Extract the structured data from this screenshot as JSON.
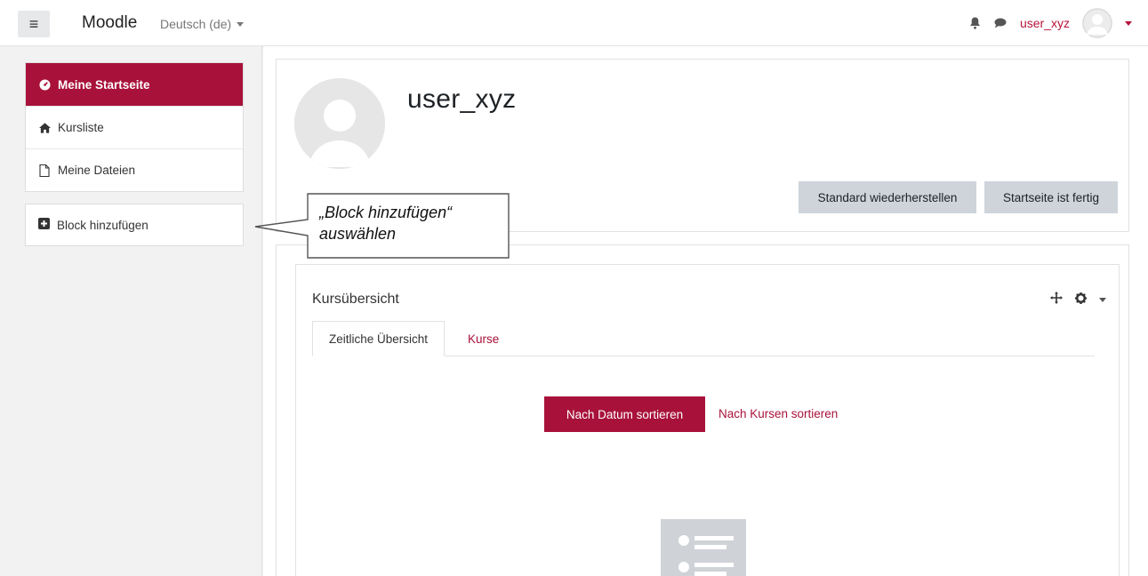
{
  "navbar": {
    "brand": "Moodle",
    "language": "Deutsch (de)",
    "username": "user_xyz",
    "icons": [
      "menu-icon",
      "bell-icon",
      "chat-icon",
      "avatar",
      "chevron-down-icon"
    ]
  },
  "drawer": {
    "items": [
      {
        "label": "Meine Startseite",
        "icon": "dashboard-icon",
        "active": true
      },
      {
        "label": "Kursliste",
        "icon": "home-icon",
        "active": false
      },
      {
        "label": "Meine Dateien",
        "icon": "file-icon",
        "active": false
      }
    ],
    "add_block": {
      "label": "Block hinzufügen",
      "icon": "plus-square-icon"
    }
  },
  "header": {
    "name": "user_xyz",
    "buttons": {
      "reset": "Standard wiederherstellen",
      "done": "Startseite ist fertig"
    }
  },
  "block": {
    "title": "Kursübersicht",
    "tabs": [
      {
        "label": "Zeitliche Übersicht",
        "active": true
      },
      {
        "label": "Kurse",
        "active": false
      }
    ],
    "sort_date": "Nach Datum sortieren",
    "sort_course": "Nach Kursen sortieren"
  },
  "callout": {
    "line1": "„Block hinzufügen“",
    "line2": "auswählen"
  },
  "colors": {
    "accent": "#a8123a",
    "link": "#b7133a",
    "button_gray": "#ced4da",
    "background": "#f2f2f2"
  }
}
